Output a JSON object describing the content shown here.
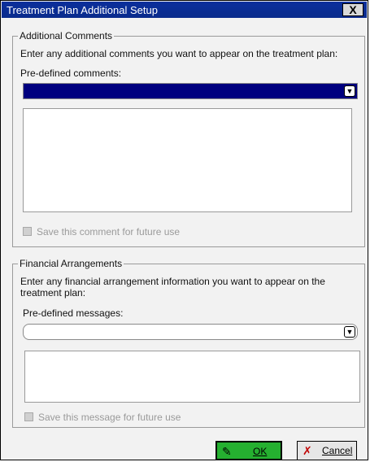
{
  "window": {
    "title": "Treatment Plan Additional Setup",
    "close_label": "X"
  },
  "comments": {
    "legend": "Additional Comments",
    "instruction": "Enter any additional comments you want to appear on the treatment plan:",
    "predefined_label": "Pre-defined comments:",
    "dropdown_value": "",
    "textarea_value": "",
    "save_label": "Save this comment for future use",
    "save_checked": false
  },
  "financial": {
    "legend": "Financial Arrangements",
    "instruction_line1": "Enter any financial arrangement information you want to appear on the",
    "instruction_line2": "treatment plan:",
    "predefined_label": "Pre-defined messages:",
    "dropdown_value": "",
    "textarea_value": "",
    "save_label": "Save this message for future use",
    "save_checked": false
  },
  "buttons": {
    "ok_label": "OK",
    "cancel_label": "Cancel"
  },
  "colors": {
    "title_bar": "#0a2b8c",
    "selected_dropdown": "#00007f",
    "ok_button": "#25b030"
  },
  "icons": {
    "dropdown": "chevron-down-icon",
    "ok": "pencil-check-icon",
    "cancel": "pencil-x-icon"
  }
}
